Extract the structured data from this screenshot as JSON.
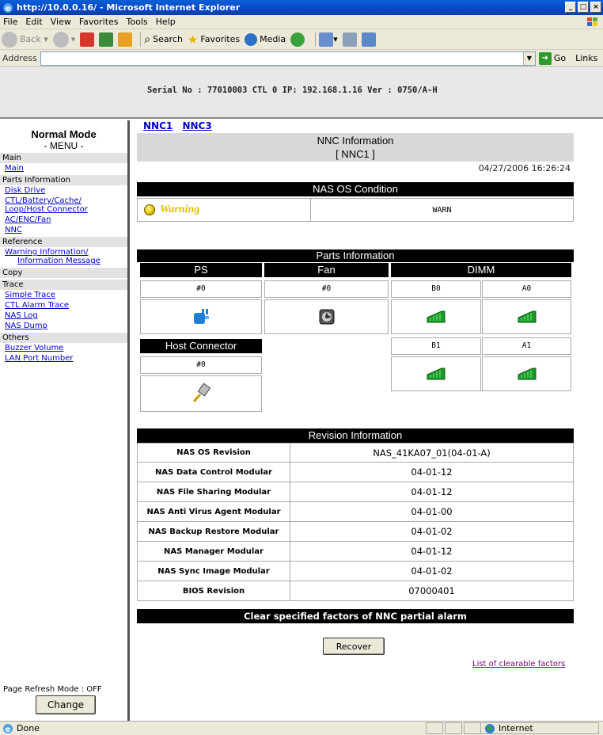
{
  "window": {
    "title": "http://10.0.0.16/ - Microsoft Internet Explorer"
  },
  "menubar": {
    "items": [
      "File",
      "Edit",
      "View",
      "Favorites",
      "Tools",
      "Help"
    ]
  },
  "toolbar": {
    "back": "Back",
    "search": "Search",
    "favorites": "Favorites",
    "media": "Media"
  },
  "address": {
    "label": "Address",
    "value": "",
    "go": "Go",
    "links": "Links"
  },
  "header": {
    "serial": "Serial No : 77010003  CTL 0  IP: 192.168.1.16  Ver : 0750/A-H"
  },
  "nav": {
    "mode": "Normal Mode",
    "menu_title": "- MENU -",
    "sections": [
      {
        "title": "Main",
        "links": [
          "Main"
        ]
      },
      {
        "title": "Parts Information",
        "links": [
          "Disk Drive",
          "CTL/Battery/Cache/",
          "Loop/Host Connector",
          "AC/ENC/Fan",
          "NNC"
        ]
      },
      {
        "title": "Reference",
        "links": [
          "Warning Information/",
          "Information Message"
        ]
      },
      {
        "title": "Copy",
        "links": []
      },
      {
        "title": "Trace",
        "links": [
          "Simple Trace",
          "CTL Alarm Trace",
          "NAS Log",
          "NAS Dump"
        ]
      },
      {
        "title": "Others",
        "links": [
          "Buzzer Volume",
          "LAN Port Number"
        ]
      }
    ],
    "refresh_mode": "Page Refresh Mode : OFF",
    "change_button": "Change"
  },
  "main": {
    "tabs": [
      "NNC1",
      "NNC3"
    ],
    "info_title": "NNC Information",
    "info_sub": "[ NNC1 ]",
    "datetime": "04/27/2006 16:26:24",
    "os_condition": {
      "header": "NAS OS Condition",
      "status_label": "Warning",
      "status_value": "WARN"
    },
    "parts": {
      "header": "Parts Information",
      "ps": {
        "label": "PS",
        "num": "#0"
      },
      "fan": {
        "label": "Fan",
        "num": "#0"
      },
      "dimm": {
        "label": "DIMM",
        "slots": [
          "B0",
          "A0",
          "B1",
          "A1"
        ]
      },
      "host": {
        "label": "Host Connector",
        "num": "#0"
      }
    },
    "revision": {
      "header": "Revision Information",
      "rows": [
        {
          "k": "NAS OS Revision",
          "v": "NAS_41KA07_01(04-01-A)"
        },
        {
          "k": "NAS Data Control Modular",
          "v": "04-01-12"
        },
        {
          "k": "NAS File Sharing Modular",
          "v": "04-01-12"
        },
        {
          "k": "NAS Anti Virus Agent Modular",
          "v": "04-01-00"
        },
        {
          "k": "NAS Backup Restore Modular",
          "v": "04-01-02"
        },
        {
          "k": "NAS Manager Modular",
          "v": "04-01-12"
        },
        {
          "k": "NAS Sync Image Modular",
          "v": "04-01-02"
        },
        {
          "k": "BIOS Revision",
          "v": "07000401"
        }
      ]
    },
    "alarm": {
      "header": "Clear specified factors of NNC partial alarm",
      "recover_button": "Recover",
      "clearable_link": "List of clearable factors"
    }
  },
  "status": {
    "text": "Done",
    "zone": "Internet"
  }
}
